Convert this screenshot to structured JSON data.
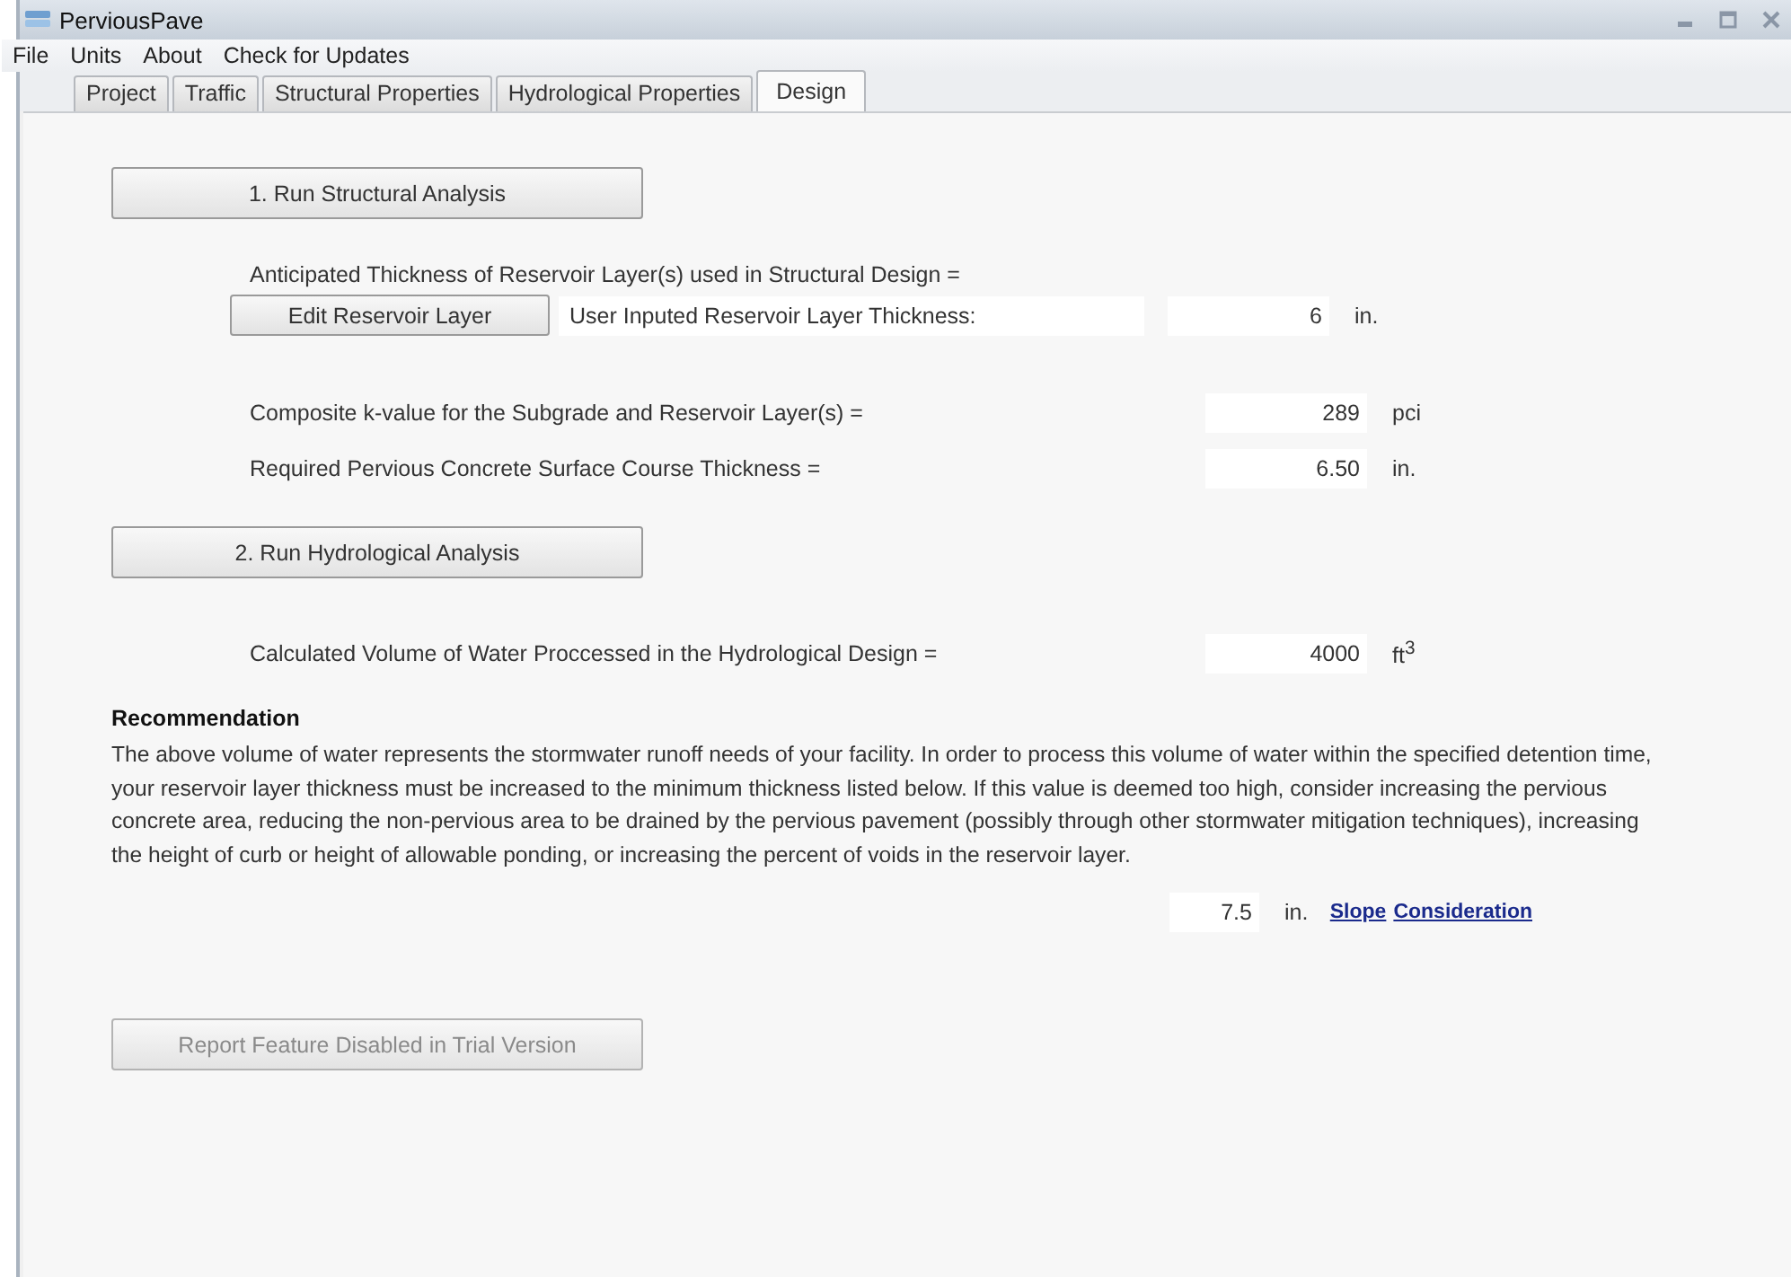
{
  "window": {
    "title": "PerviousPave"
  },
  "menu": [
    "File",
    "Units",
    "About",
    "Check for Updates"
  ],
  "tabs": [
    {
      "label": "Project",
      "selected": false
    },
    {
      "label": "Traffic",
      "selected": false
    },
    {
      "label": "Structural Properties",
      "selected": false
    },
    {
      "label": "Hydrological Properties",
      "selected": false
    },
    {
      "label": "Design",
      "selected": true
    }
  ],
  "design": {
    "rows": [
      {
        "kind": "button",
        "label": "1. Run Structural Analysis",
        "disabled": false
      },
      {
        "kind": "note",
        "text": "Anticipated Thickness of Reservoir Layer(s) used in Structural Design ="
      },
      {
        "kind": "edit",
        "button": "Edit Reservoir Layer",
        "field": "User Inputed Reservoir Layer Thickness:",
        "value": "6",
        "unit": "in."
      },
      {
        "kind": "value",
        "label": "Composite k-value for the Subgrade and Reservoir Layer(s) =",
        "value": "289",
        "unit": "pci"
      },
      {
        "kind": "value",
        "label": "Required Pervious Concrete Surface Course Thickness =",
        "value": "6.50",
        "unit": "in."
      },
      {
        "kind": "button",
        "label": "2. Run Hydrological Analysis",
        "disabled": false
      },
      {
        "kind": "value",
        "label": "Calculated Volume of Water Proccessed in the Hydrological Design =",
        "value": "4000",
        "unit": "ft$^{3}$"
      }
    ],
    "recommendation": {
      "heading": "Recommendation",
      "text": "The above volume of water represents the stormwater runoff needs of your facility.  In order to process this volume of water within the specified detention time, your reservoir layer thickness must be increased to the minimum thickness listed below.  If this value is deemed too high, consider increasing the pervious concrete area, reducing the non-pervious area to be drained by the pervious pavement (possibly through other stormwater mitigation techniques), increasing the height of curb or height of allowable ponding, or increasing the percent of voids in the reservoir layer.",
      "value": "7.5",
      "unit": "in.",
      "links": [
        "Slope",
        "Consideration"
      ]
    },
    "report_button": {
      "label": "Report Feature Disabled in Trial Version",
      "disabled": true
    }
  }
}
